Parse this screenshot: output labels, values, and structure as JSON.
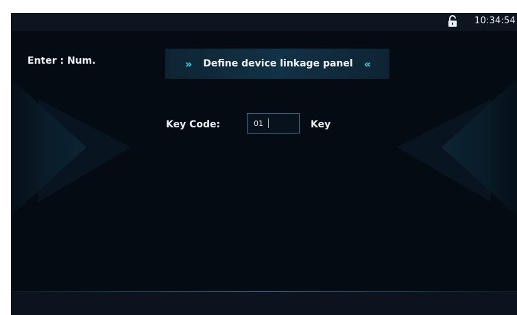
{
  "status_bar": {
    "lock_icon": "unlocked-padlock-icon",
    "time": "10:34:54"
  },
  "hint": {
    "text": "Enter : Num."
  },
  "title_panel": {
    "left_chevron": "»",
    "title": "Define device linkage panel",
    "right_chevron": "«",
    "accent_color": "#33d6f0"
  },
  "key_code": {
    "label": "Key Code:",
    "value": "01",
    "unit": "Key"
  },
  "colors": {
    "background": "#050b13",
    "status_bar": "#0d1620",
    "input_border": "#3d6f8c"
  }
}
